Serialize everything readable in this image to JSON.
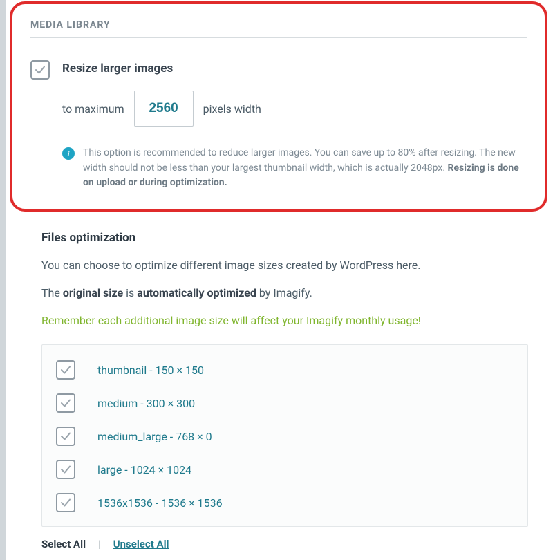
{
  "section_label": "MEDIA LIBRARY",
  "resize": {
    "title": "Resize larger images",
    "to_max": "to maximum",
    "value": "2560",
    "pixels_width": "pixels width",
    "info_prefix": "This option is recommended to reduce larger images. You can save up to 80% after resizing. The new width should not be less than your largest thumbnail width, which is actually 2048px. ",
    "info_bold": "Resizing is done on upload or during optimization."
  },
  "files": {
    "title": "Files optimization",
    "intro": "You can choose to optimize different image sizes created by WordPress here.",
    "line2_a": "The ",
    "line2_b": "original size",
    "line2_c": " is ",
    "line2_d": "automatically optimized",
    "line2_e": " by Imagify.",
    "warning": "Remember each additional image size will affect your Imagify monthly usage!",
    "sizes": [
      "thumbnail - 150 × 150",
      "medium - 300 × 300",
      "medium_large - 768 × 0",
      "large - 1024 × 1024",
      "1536x1536 - 1536 × 1536"
    ],
    "select_all": "Select All",
    "unselect_all": "Unselect All"
  }
}
